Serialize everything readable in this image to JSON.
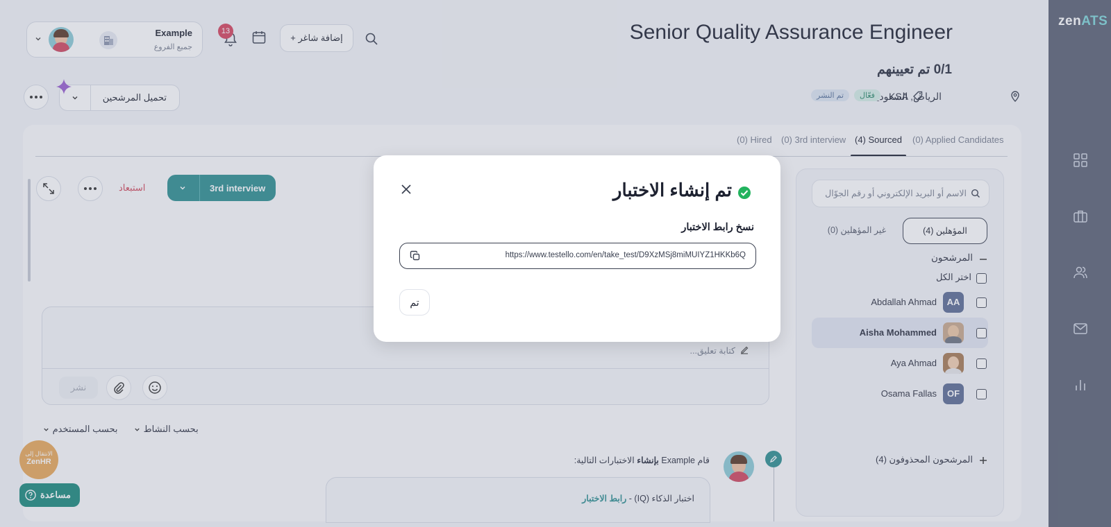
{
  "app": {
    "logo_main": "zen",
    "logo_accent": "ATS"
  },
  "header": {
    "job_title": "Senior Quality Assurance Engineer",
    "assigned": "0/1 تم تعيينهم",
    "location": "الرياض, السعودية",
    "tag": "KSA",
    "status_active": "فعّال",
    "status_published": "تم النشر",
    "company_name": "Example",
    "company_branch": "جميع الفروع",
    "notifications_count": "13",
    "add_vacancy": "+ إضافة شاغر",
    "upload_candidates": "تحميل المرشحين"
  },
  "tabs": [
    "(0) Applied Candidates",
    "(4) Sourced",
    "(0) 3rd interview",
    "(0) Hired"
  ],
  "candidate_panel": {
    "search_placeholder": "الاسم أو البريد الإلكتروني أو رقم الجوّال",
    "qualified": "المؤهلين (4)",
    "unqualified": "غير المؤهلين (0)",
    "group": "المرشحون",
    "select_all": "اختر الكل",
    "deleted": "المرشحون المحذوفون (4)",
    "candidates": [
      {
        "name": "Abdallah Ahmad",
        "initials": "AA"
      },
      {
        "name": "Aisha Mohammed",
        "initials": ""
      },
      {
        "name": "Aya Ahmad",
        "initials": ""
      },
      {
        "name": "Osama Fallas",
        "initials": "OF"
      }
    ]
  },
  "detail": {
    "stage_button": "3rd interview",
    "exclude": "استبعاد",
    "comment_placeholder": "كتابة تعليق...",
    "publish": "نشر",
    "filter_activity": "بحسب النشاط",
    "filter_user": "بحسب المستخدم",
    "activity_prefix": "قام Example",
    "activity_bold": "بإنشاء",
    "activity_suffix": "الاختبارات التالية:",
    "activity_test": "اختبار الذكاء (IQ) -",
    "activity_link": "رابط الاختبار"
  },
  "floating": {
    "zenhr_line1": "الانتقال إلى",
    "zenhr_line2": "ZenHR",
    "help": "مساعدة"
  },
  "modal": {
    "title": "تم إنشاء الاختبار",
    "copy_label": "نسخ رابط الاختبار",
    "url": "https://www.testello.com/en/take_test/D9XzMSj8miMUIYZ1HKKb6Q",
    "done": "تم"
  },
  "colors": {
    "teal": "#2e8f91",
    "danger": "#d0475a",
    "rail": "#5b6275",
    "badge_red": "#d6455e",
    "zenhr": "#e9a95a",
    "help": "#1b8a7c"
  }
}
